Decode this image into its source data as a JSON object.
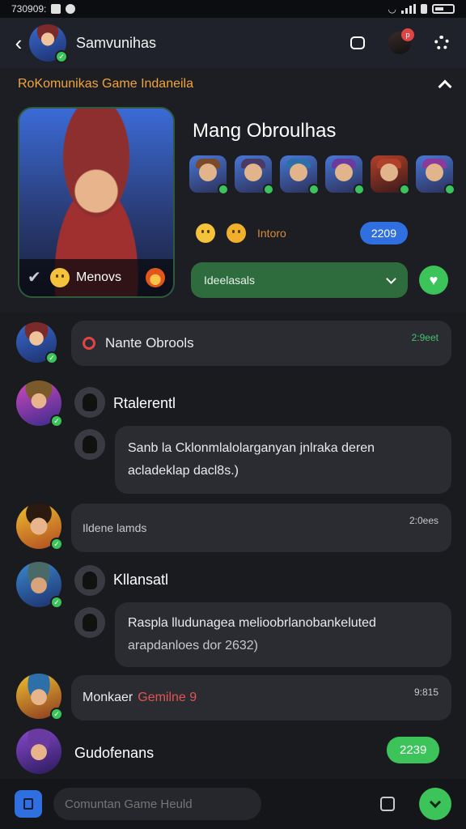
{
  "status_bar": {
    "time": "7:30",
    "left_text": "730909:",
    "icons": [
      "image-icon",
      "notification-icon",
      "wifi-icon",
      "signal-icon",
      "mute-icon",
      "battery-icon"
    ]
  },
  "header": {
    "title": "Samvunihas",
    "icons": [
      "back-arrow-icon",
      "chat-icon",
      "notification-avatar",
      "settings-icon"
    ],
    "badge": "p"
  },
  "group": {
    "name": "RoKomunikas Game Indaneila",
    "collapse_icon": "chevron-up-icon"
  },
  "profile": {
    "title": "Mang Obroulhas",
    "hero_label": "Menovs",
    "reaction_label": "Intoro",
    "counter_pill": "2209",
    "dropdown_value": "Ideelasals",
    "member_hats": [
      "#7a4a2a",
      "#4a3a6a",
      "#2d6fa8",
      "#6a3aa0",
      "#b0402a",
      "#8a3a9a"
    ]
  },
  "feed": {
    "messages": [
      {
        "type": "system",
        "text": "Nante Obrools",
        "time": "2:9eet"
      },
      {
        "type": "message",
        "sender": "Rtalerentl",
        "line1": "Sanb la Cklonmlalolarganyan jnlraka deren",
        "line2": "acladeklap dacl8s.)"
      },
      {
        "type": "notice",
        "text": "Ildene lamds",
        "time": "2:0ees"
      },
      {
        "type": "message",
        "sender": "Kllansatl",
        "line1": "Raspla lludunagea melioobrlanobankeluted",
        "line2": "arapdanloes dor 2632)"
      },
      {
        "type": "system",
        "text": "Monkaer",
        "highlight": "Gemilne 9",
        "time": "9:815"
      },
      {
        "type": "user",
        "sender": "Gudofenans",
        "pill": "2239"
      }
    ]
  },
  "composer": {
    "placeholder": "Comuntan Game Heuld"
  },
  "colors": {
    "accent_green": "#3cc45a",
    "accent_blue": "#2f6fe0",
    "accent_orange": "#f0a43a",
    "bg": "#1a1b1f"
  }
}
